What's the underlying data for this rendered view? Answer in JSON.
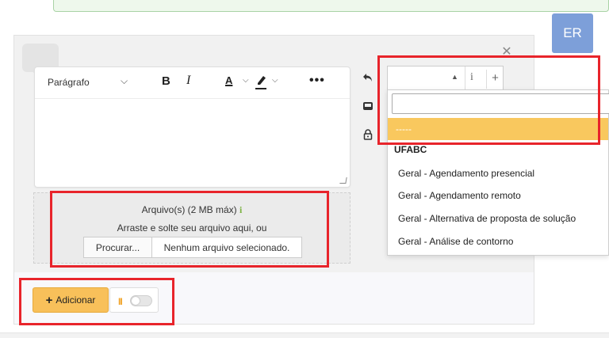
{
  "user": {
    "initials": "ER"
  },
  "editor": {
    "paragraph_label": "Parágrafo",
    "bold": "B",
    "italic": "I",
    "font_color": "A",
    "more": "•••"
  },
  "attachments": {
    "title": "Arquivo(s) (2 MB máx)",
    "info_glyph": "i",
    "drop_text": "Arraste e solte seu arquivo aqui, ou",
    "browse_label": "Procurar...",
    "no_file_label": "Nenhum arquivo selecionado."
  },
  "actions": {
    "add_label": "Adicionar",
    "add_plus": "+",
    "pause_glyph": "II"
  },
  "selector": {
    "info_glyph": "i",
    "add_glyph": "+",
    "search_value": "",
    "selected_option": "-----",
    "group_label": "UFABC",
    "options": [
      "Geral - Agendamento presencial",
      "Geral - Agendamento remoto",
      "Geral - Alternativa de proposta de solução",
      "Geral - Análise de contorno"
    ]
  },
  "colors": {
    "highlight": "#e8242b",
    "accent": "#f8c05a",
    "selected_option_bg": "#f9c85e",
    "avatar_bg": "#7d9fd9",
    "info_green": "#7bb241"
  }
}
